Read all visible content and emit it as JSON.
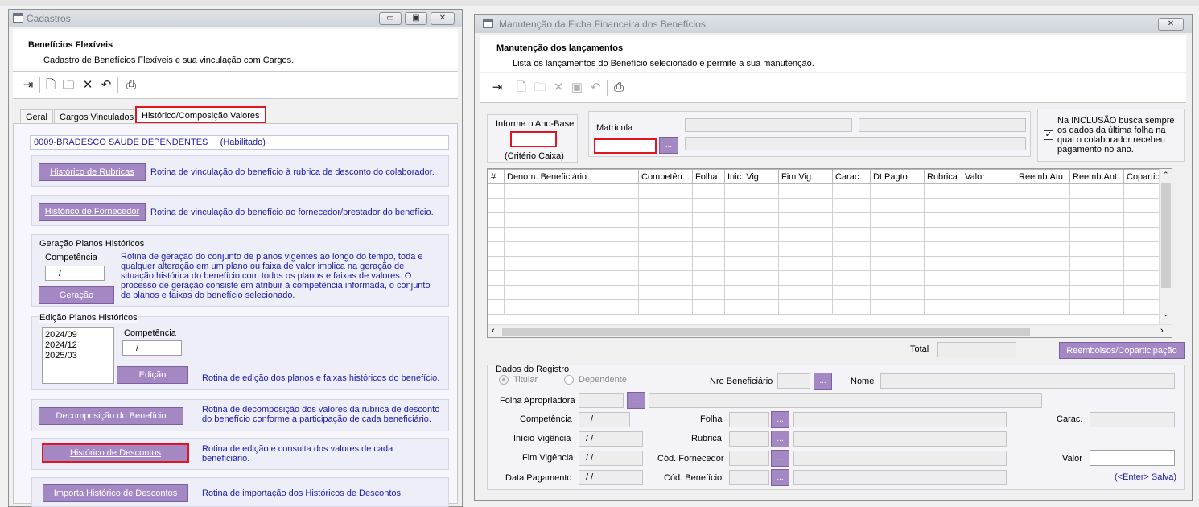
{
  "left_window": {
    "title": "Cadastros",
    "header_title": "Benefícios Flexíveis",
    "header_subtitle": "Cadastro de Benefícios Flexíveis e sua vinculação com Cargos.",
    "tabs": [
      "Geral",
      "Cargos Vinculados",
      "Histórico/Composição Valores"
    ],
    "benefit": "0009-BRADESCO SAUDE DEPENDENTES     (Habilitado)",
    "historico_rubricas": {
      "button": "Histórico de Rubricas",
      "desc": "Rotina de vinculação do benefício à rubrica de desconto do colaborador."
    },
    "historico_fornecedor": {
      "button": "Histórico de Fornecedor",
      "desc": "Rotina de vinculação do benefício ao fornecedor/prestador do benefício."
    },
    "geracao": {
      "group": "Geração Planos Históricos",
      "competencia_label": "Competência",
      "competencia_value": "/",
      "button": "Geração",
      "desc": "Rotina de geração do conjunto de planos vigentes ao longo do tempo, toda e qualquer alteração em um plano ou faixa de valor implica na geração de situação histórica do benefício com todos os planos e faixas de valores. O processo de geração consiste em atribuir à competência informada, o conjunto de planos e faixas do benefício selecionado."
    },
    "edicao": {
      "group": "Edição Planos Históricos",
      "list": [
        "2024/09",
        "2024/12",
        "2025/03"
      ],
      "competencia_label": "Competência",
      "competencia_value": "/",
      "button": "Edição",
      "desc": "Rotina de edição dos planos e faixas históricos do benefício."
    },
    "decomposicao": {
      "button": "Decomposição do Benefício",
      "desc": "Rotina de decomposição dos valores da rubrica de desconto do benefício conforme a participação de cada beneficiário."
    },
    "historico_descontos": {
      "button": "Histórico de Descontos",
      "desc": "Rotina de edição e consulta dos valores de cada beneficiário."
    },
    "importa": {
      "button": "Importa Histórico de Descontos",
      "desc": "Rotina de importação dos Históricos de Descontos."
    }
  },
  "right_window": {
    "title": "Manutenção da Ficha Financeira dos Benefícios",
    "header_title": "Manutenção dos lançamentos",
    "header_subtitle": "Lista os lançamentos do Benefício selecionado e permite a sua manutenção.",
    "ano_base_label": "Informe o Ano-Base",
    "criterio": "(Critério Caixa)",
    "matricula_label": "Matrícula",
    "dots": "...",
    "checkbox_text": "Na INCLUSÃO busca sempre os dados da última folha na qual o colaborador recebeu pagamento no ano.",
    "columns": [
      "#",
      "Denom. Beneficiário",
      "Competên...",
      "Folha",
      "Inic. Vig.",
      "Fim Vig.",
      "Carac.",
      "Dt Pagto",
      "Rubrica",
      "Valor",
      "Reemb.Atu",
      "Reemb.Ant",
      "Coparticip."
    ],
    "total_label": "Total",
    "reembolsos_button": "Reembolsos/Coparticipação",
    "dados_registro": "Dados do Registro",
    "radio_titular": "Titular",
    "radio_dependente": "Dependente",
    "nro_beneficiario": "Nro Beneficiário",
    "nome": "Nome",
    "folha_apropriadora": "Folha Apropriadora",
    "competencia": "Competência",
    "competencia_value": "/",
    "inicio_vigencia": "Início Vigência",
    "fim_vigencia": "Fim Vigência",
    "data_pagamento": "Data Pagamento",
    "date_value": "/ /",
    "folha": "Folha",
    "rubrica": "Rubrica",
    "cod_fornecedor": "Cód. Fornecedor",
    "cod_beneficio": "Cód. Benefício",
    "carac": "Carac.",
    "valor": "Valor",
    "enter_salva": "(<Enter> Salva)"
  }
}
